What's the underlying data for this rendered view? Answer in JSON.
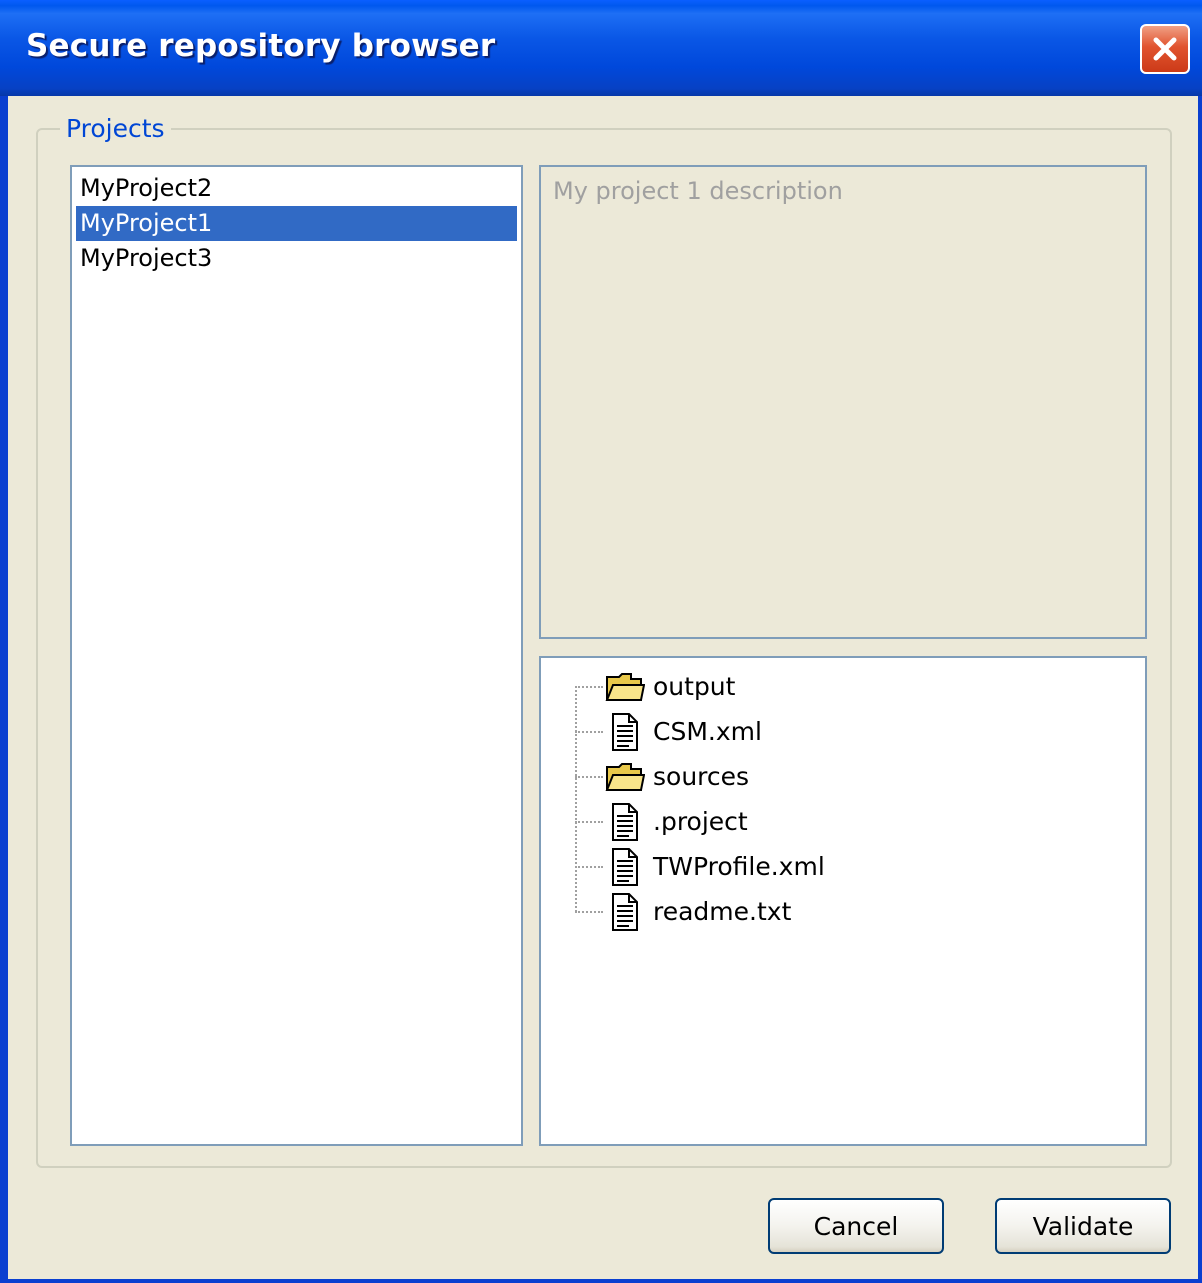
{
  "window": {
    "title": "Secure repository browser"
  },
  "projects_group": {
    "legend": "Projects"
  },
  "projects": {
    "items": [
      {
        "label": "MyProject2",
        "selected": false
      },
      {
        "label": "MyProject1",
        "selected": true
      },
      {
        "label": "MyProject3",
        "selected": false
      }
    ]
  },
  "description": {
    "text": "My project 1 description"
  },
  "file_tree": {
    "items": [
      {
        "label": "output",
        "icon": "folder-icon"
      },
      {
        "label": "CSM.xml",
        "icon": "file-icon"
      },
      {
        "label": "sources",
        "icon": "folder-icon"
      },
      {
        "label": ".project",
        "icon": "file-icon"
      },
      {
        "label": "TWProfile.xml",
        "icon": "file-icon"
      },
      {
        "label": "readme.txt",
        "icon": "file-icon"
      }
    ]
  },
  "buttons": {
    "cancel": "Cancel",
    "validate": "Validate"
  },
  "colors": {
    "titlebar": "#0058ee",
    "selection": "#316ac5",
    "legend": "#0046d5",
    "close": "#e1542f"
  }
}
